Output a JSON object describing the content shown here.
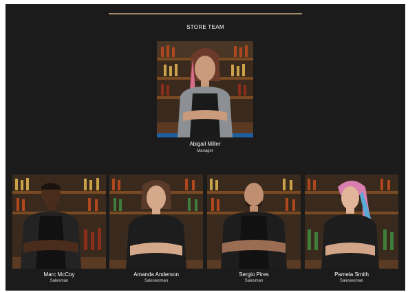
{
  "section": {
    "title": "STORE TEAM"
  },
  "colors": {
    "background": "#1b1b1b",
    "accent_rule": "#a08b66",
    "text": "#ffffff"
  },
  "manager": {
    "name": "Abigail Miller",
    "role": "Manager"
  },
  "team": [
    {
      "name": "Marc McCoy",
      "role": "Salesman"
    },
    {
      "name": "Amanda Anderson",
      "role": "Saleswoman"
    },
    {
      "name": "Sergio Pires",
      "role": "Salesman"
    },
    {
      "name": "Pamela Smith",
      "role": "Saleswoman"
    }
  ]
}
